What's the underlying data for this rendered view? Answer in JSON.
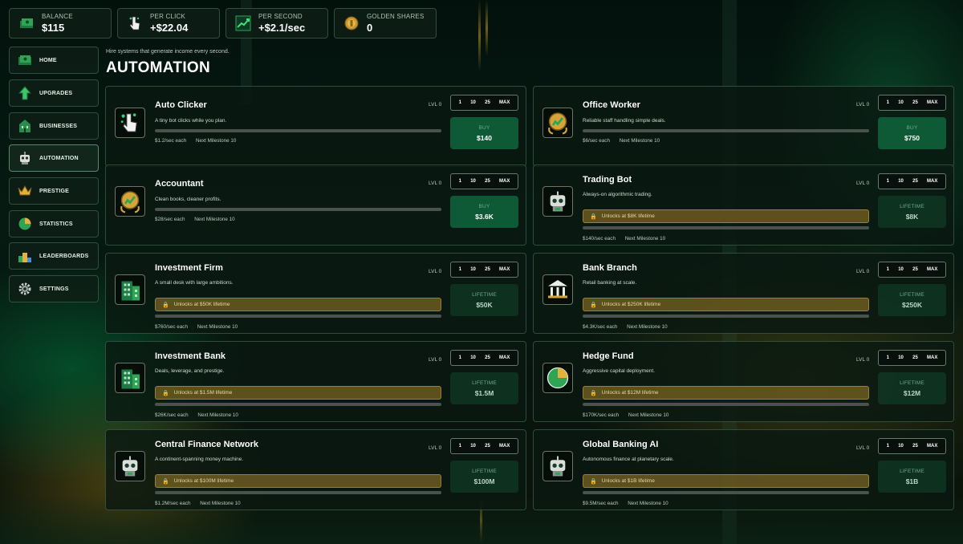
{
  "colors": {
    "accent": "#0f5a36",
    "gold": "#d4a63a",
    "panel": "#0a1811"
  },
  "stats": [
    {
      "label": "BALANCE",
      "value": "$115",
      "icon": "cash-stack-icon"
    },
    {
      "label": "PER CLICK",
      "value": "+$22.04",
      "icon": "pointer-click-icon"
    },
    {
      "label": "PER SECOND",
      "value": "+$2.1/sec",
      "icon": "growth-chart-icon"
    },
    {
      "label": "GOLDEN SHARES",
      "value": "0",
      "icon": "gold-coin-icon"
    }
  ],
  "nav": [
    {
      "label": "HOME",
      "icon": "money-home-icon"
    },
    {
      "label": "UPGRADES",
      "icon": "arrow-up-icon"
    },
    {
      "label": "BUSINESSES",
      "icon": "building-icon"
    },
    {
      "label": "AUTOMATION",
      "icon": "robot-icon"
    },
    {
      "label": "PRESTIGE",
      "icon": "crown-icon"
    },
    {
      "label": "STATISTICS",
      "icon": "pie-chart-icon"
    },
    {
      "label": "LEADERBOARDS",
      "icon": "podium-icon"
    },
    {
      "label": "SETTINGS",
      "icon": "gear-icon"
    }
  ],
  "page": {
    "subtitle": "Hire systems that generate income every second.",
    "title": "AUTOMATION"
  },
  "quantity_options": [
    "1",
    "10",
    "25",
    "MAX"
  ],
  "cards": [
    {
      "name": "Auto Clicker",
      "level": "LVL 0",
      "desc": "A tiny bot clicks while you plan.",
      "lock": "",
      "rate": "$1.2/sec each",
      "milestone": "Next Milestone 10",
      "button_label": "BUY",
      "button_value": "$140",
      "state": "active",
      "icon": "pointer-click-icon"
    },
    {
      "name": "Office Worker",
      "level": "LVL 0",
      "desc": "Reliable staff handling simple deals.",
      "lock": "",
      "rate": "$6/sec each",
      "milestone": "Next Milestone 10",
      "button_label": "BUY",
      "button_value": "$750",
      "state": "active",
      "icon": "gold-medal-icon"
    },
    {
      "name": "Accountant",
      "level": "LVL 0",
      "desc": "Clean books, cleaner profits.",
      "lock": "",
      "rate": "$28/sec each",
      "milestone": "Next Milestone 10",
      "button_label": "BUY",
      "button_value": "$3.6K",
      "state": "active",
      "icon": "gold-medal-icon"
    },
    {
      "name": "Trading Bot",
      "level": "LVL 0",
      "desc": "Always-on algorithmic trading.",
      "lock": "Unlocks at $8K lifetime",
      "rate": "$140/sec each",
      "milestone": "Next Milestone 10",
      "button_label": "LIFETIME",
      "button_value": "$8K",
      "state": "locked",
      "icon": "robot-icon"
    },
    {
      "name": "Investment Firm",
      "level": "LVL 0",
      "desc": "A small desk with large ambitions.",
      "lock": "Unlocks at $50K lifetime",
      "rate": "$760/sec each",
      "milestone": "Next Milestone 10",
      "button_label": "LIFETIME",
      "button_value": "$50K",
      "state": "locked",
      "icon": "office-building-icon"
    },
    {
      "name": "Bank Branch",
      "level": "LVL 0",
      "desc": "Retail banking at scale.",
      "lock": "Unlocks at $250K lifetime",
      "rate": "$4.3K/sec each",
      "milestone": "Next Milestone 10",
      "button_label": "LIFETIME",
      "button_value": "$250K",
      "state": "locked",
      "icon": "bank-icon"
    },
    {
      "name": "Investment Bank",
      "level": "LVL 0",
      "desc": "Deals, leverage, and prestige.",
      "lock": "Unlocks at $1.5M lifetime",
      "rate": "$26K/sec each",
      "milestone": "Next Milestone 10",
      "button_label": "LIFETIME",
      "button_value": "$1.5M",
      "state": "locked",
      "icon": "office-building-icon"
    },
    {
      "name": "Hedge Fund",
      "level": "LVL 0",
      "desc": "Aggressive capital deployment.",
      "lock": "Unlocks at $12M lifetime",
      "rate": "$170K/sec each",
      "milestone": "Next Milestone 10",
      "button_label": "LIFETIME",
      "button_value": "$12M",
      "state": "locked",
      "icon": "pie-chart-icon"
    },
    {
      "name": "Central Finance Network",
      "level": "LVL 0",
      "desc": "A continent-spanning money machine.",
      "lock": "Unlocks at $100M lifetime",
      "rate": "$1.2M/sec each",
      "milestone": "Next Milestone 10",
      "button_label": "LIFETIME",
      "button_value": "$100M",
      "state": "locked",
      "icon": "robot-icon"
    },
    {
      "name": "Global Banking AI",
      "level": "LVL 0",
      "desc": "Autonomous finance at planetary scale.",
      "lock": "Unlocks at $1B lifetime",
      "rate": "$9.5M/sec each",
      "milestone": "Next Milestone 10",
      "button_label": "LIFETIME",
      "button_value": "$1B",
      "state": "locked",
      "icon": "robot-icon"
    }
  ]
}
